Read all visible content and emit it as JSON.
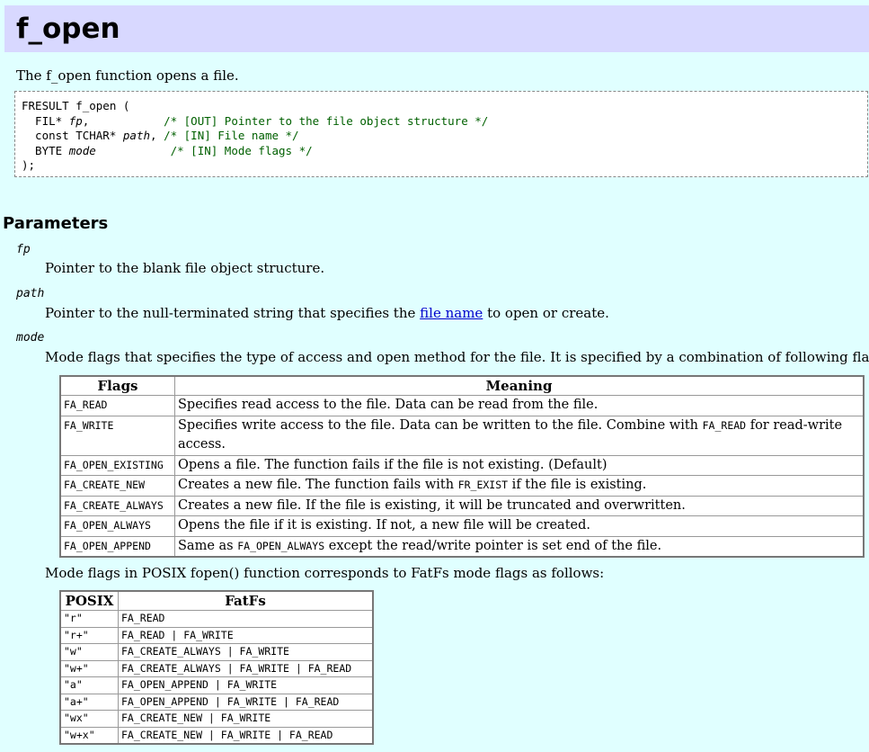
{
  "title": "f_open",
  "intro": "The f_open function opens a file.",
  "prototype": {
    "line1": "FRESULT f_open (",
    "params": [
      {
        "type": "  FIL* ",
        "name": "fp",
        "sep": ",",
        "pad": "           ",
        "comment": "/* [OUT] Pointer to the file object structure */"
      },
      {
        "type": "  const TCHAR* ",
        "name": "path",
        "sep": ",",
        "pad": " ",
        "comment": "/* [IN] File name */"
      },
      {
        "type": "  BYTE ",
        "name": "mode",
        "sep": "",
        "pad": "           ",
        "comment": "/* [IN] Mode flags */"
      }
    ],
    "close": ");"
  },
  "parameters": {
    "heading": "Parameters",
    "fp": {
      "name": "fp",
      "desc": "Pointer to the blank file object structure."
    },
    "path": {
      "name": "path",
      "desc_before": "Pointer to the null-terminated string that specifies the ",
      "link": "file name",
      "desc_after": " to open or create."
    },
    "mode": {
      "name": "mode",
      "desc": "Mode flags that specifies the type of access and open method for the file. It is specified by a combination of following flags."
    }
  },
  "flags_table": {
    "headers": [
      "Flags",
      "Meaning"
    ],
    "rows": [
      {
        "flag": "FA_READ",
        "meaning": "Specifies read access to the file. Data can be read from the file."
      },
      {
        "flag": "FA_WRITE",
        "meaning_before": "Specifies write access to the file. Data can be written to the file. Combine with ",
        "code": "FA_READ",
        "meaning_after": " for read-write access."
      },
      {
        "flag": "FA_OPEN_EXISTING",
        "meaning": "Opens a file. The function fails if the file is not existing. (Default)"
      },
      {
        "flag": "FA_CREATE_NEW",
        "meaning_before": "Creates a new file. The function fails with ",
        "code": "FR_EXIST",
        "meaning_after": " if the file is existing."
      },
      {
        "flag": "FA_CREATE_ALWAYS",
        "meaning": "Creates a new file. If the file is existing, it will be truncated and overwritten."
      },
      {
        "flag": "FA_OPEN_ALWAYS",
        "meaning": "Opens the file if it is existing. If not, a new file will be created."
      },
      {
        "flag": "FA_OPEN_APPEND",
        "meaning_before": "Same as ",
        "code": "FA_OPEN_ALWAYS",
        "meaning_after": " except the read/write pointer is set end of the file."
      }
    ]
  },
  "posix_intro": "Mode flags in POSIX fopen() function corresponds to FatFs mode flags as follows:",
  "posix_table": {
    "headers": [
      "POSIX",
      "FatFs"
    ],
    "rows": [
      {
        "posix": "\"r\"",
        "fatfs": "FA_READ"
      },
      {
        "posix": "\"r+\"",
        "fatfs": "FA_READ | FA_WRITE"
      },
      {
        "posix": "\"w\"",
        "fatfs": "FA_CREATE_ALWAYS | FA_WRITE"
      },
      {
        "posix": "\"w+\"",
        "fatfs": "FA_CREATE_ALWAYS | FA_WRITE | FA_READ"
      },
      {
        "posix": "\"a\"",
        "fatfs": "FA_OPEN_APPEND | FA_WRITE"
      },
      {
        "posix": "\"a+\"",
        "fatfs": "FA_OPEN_APPEND | FA_WRITE | FA_READ"
      },
      {
        "posix": "\"wx\"",
        "fatfs": "FA_CREATE_NEW | FA_WRITE"
      },
      {
        "posix": "\"w+x\"",
        "fatfs": "FA_CREATE_NEW | FA_WRITE | FA_READ"
      }
    ]
  },
  "colors": {
    "title_bg": "#d8d8ff",
    "page_bg": "#e0ffff",
    "comment": "#006000",
    "link": "#0000cc"
  }
}
